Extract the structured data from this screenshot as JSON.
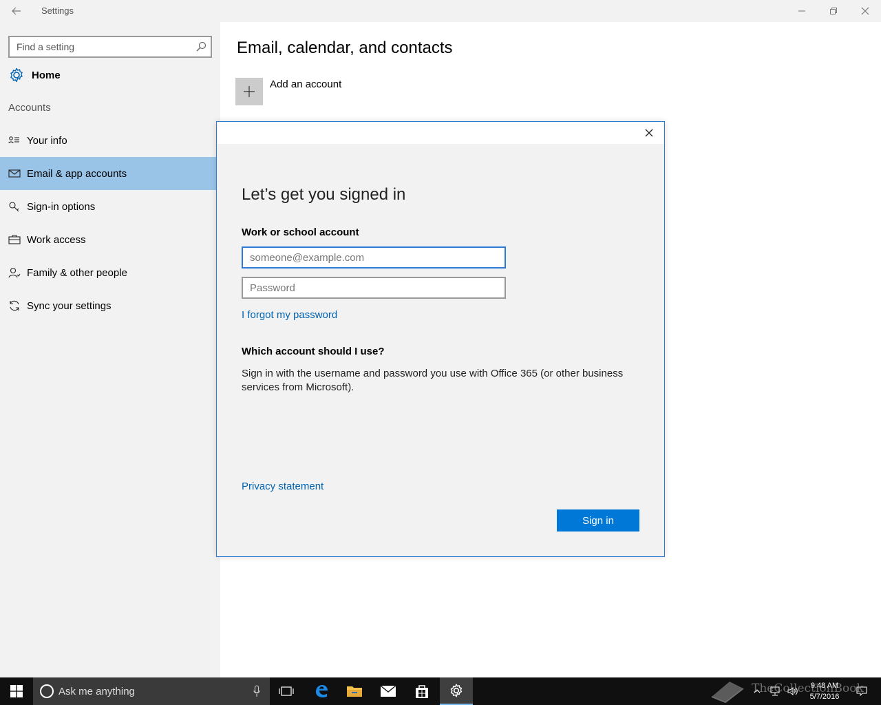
{
  "window": {
    "title": "Settings"
  },
  "sidebar": {
    "search_placeholder": "Find a setting",
    "home_label": "Home",
    "section_label": "Accounts",
    "items": [
      {
        "label": "Your info",
        "icon": "contact-card-icon"
      },
      {
        "label": "Email & app accounts",
        "icon": "mail-icon",
        "selected": true
      },
      {
        "label": "Sign-in options",
        "icon": "key-icon"
      },
      {
        "label": "Work access",
        "icon": "briefcase-icon"
      },
      {
        "label": "Family & other people",
        "icon": "person-icon"
      },
      {
        "label": "Sync your settings",
        "icon": "sync-icon"
      }
    ]
  },
  "main": {
    "title": "Email, calendar, and contacts",
    "add_account_label": "Add an account"
  },
  "dialog": {
    "title": "Let’s get you signed in",
    "field_label": "Work or school account",
    "email_placeholder": "someone@example.com",
    "password_placeholder": "Password",
    "forgot_link": "I forgot my password",
    "question_heading": "Which account should I use?",
    "question_text": "Sign in with the username and password you use with Office 365 (or other business services from Microsoft).",
    "privacy_link": "Privacy statement",
    "signin_button": "Sign in"
  },
  "taskbar": {
    "search_placeholder": "Ask me anything",
    "time": "9:48 AM",
    "date": "5/7/2016",
    "apps": [
      "task-view-icon",
      "edge-icon",
      "file-explorer-icon",
      "mail-app-icon",
      "store-icon",
      "settings-icon"
    ]
  },
  "watermark": {
    "text": "TheCollectionBook"
  },
  "colors": {
    "accent": "#0078d7",
    "selection": "#99c4e8",
    "link": "#0063b1",
    "sidebar_bg": "#f2f2f2",
    "taskbar_bg": "#101010"
  }
}
